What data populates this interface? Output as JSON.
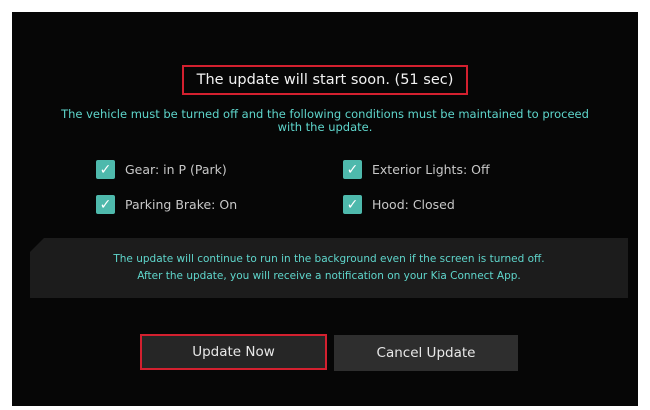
{
  "dialog": {
    "title": "The update will start soon. (51 sec)",
    "notice_line1": "The vehicle must be turned off and the following conditions must be maintained to proceed",
    "notice_line2": "with the update.",
    "conditions": [
      {
        "label": "Gear: in P (Park)",
        "checked": true
      },
      {
        "label": "Exterior Lights: Off",
        "checked": true
      },
      {
        "label": "Parking Brake: On",
        "checked": true
      },
      {
        "label": "Hood: Closed",
        "checked": true
      }
    ],
    "info_line1": "The update will continue to run in the background even if the screen is turned off.",
    "info_line2": "After the update, you will receive a notification on your Kia Connect App.",
    "update_now_label": "Update Now",
    "cancel_label": "Cancel Update"
  },
  "colors": {
    "accent_teal": "#5fd6cc",
    "checkbox": "#4eb9ac",
    "highlight_red": "#d3202f",
    "background": "#060606"
  },
  "icons": {
    "checkbox": "checkmark-icon"
  }
}
